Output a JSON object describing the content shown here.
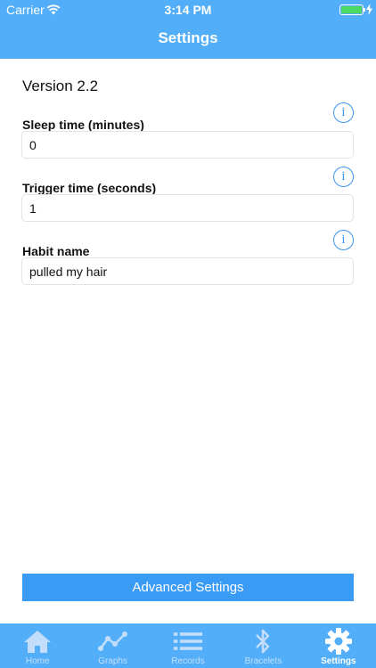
{
  "status_bar": {
    "carrier": "Carrier",
    "time": "3:14 PM"
  },
  "nav": {
    "title": "Settings"
  },
  "content": {
    "version": "Version 2.2",
    "fields": [
      {
        "label": "Sleep time (minutes)",
        "value": "0"
      },
      {
        "label": "Trigger time (seconds)",
        "value": "1"
      },
      {
        "label": "Habit name",
        "value": "pulled my hair"
      }
    ],
    "info_glyph": "i",
    "advanced_button": "Advanced Settings"
  },
  "tabbar": {
    "tabs": [
      {
        "label": "Home",
        "icon": "home-icon"
      },
      {
        "label": "Graphs",
        "icon": "graph-icon"
      },
      {
        "label": "Records",
        "icon": "list-icon"
      },
      {
        "label": "Bracelets",
        "icon": "bluetooth-icon"
      },
      {
        "label": "Settings",
        "icon": "gear-icon",
        "active": true
      }
    ]
  },
  "colors": {
    "header": "#52aef9",
    "accent": "#3a95f0",
    "button": "#3a9bf4",
    "battery": "#4cd964"
  }
}
